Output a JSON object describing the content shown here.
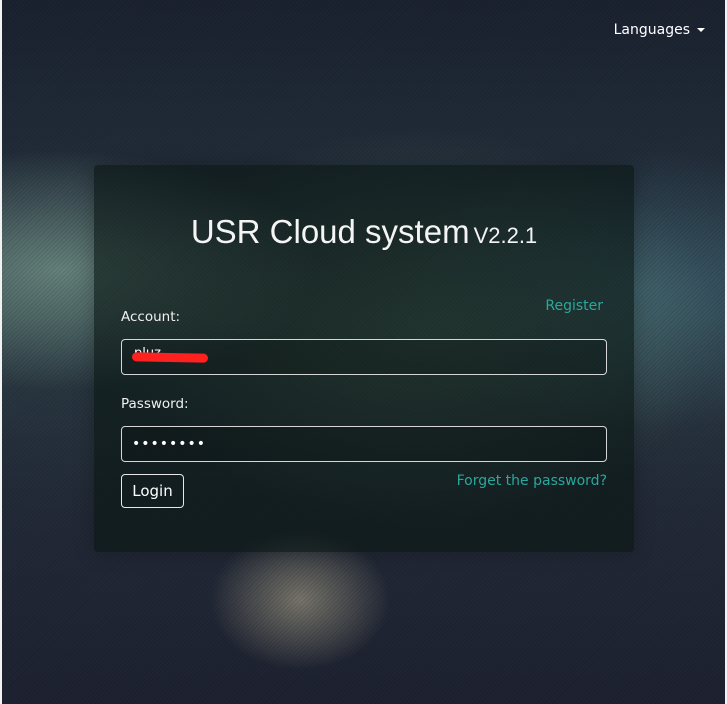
{
  "header": {
    "languages_label": "Languages"
  },
  "login": {
    "title": "USR Cloud system",
    "version": "V2.2.1",
    "account_label": "Account:",
    "register_link": "Register",
    "account_value": "pluz",
    "password_label": "Password:",
    "password_value": "••••••••",
    "forgot_link": "Forget the password?",
    "login_button": "Login"
  },
  "colors": {
    "link": "#2ba79b",
    "redaction": "#ff2020"
  }
}
